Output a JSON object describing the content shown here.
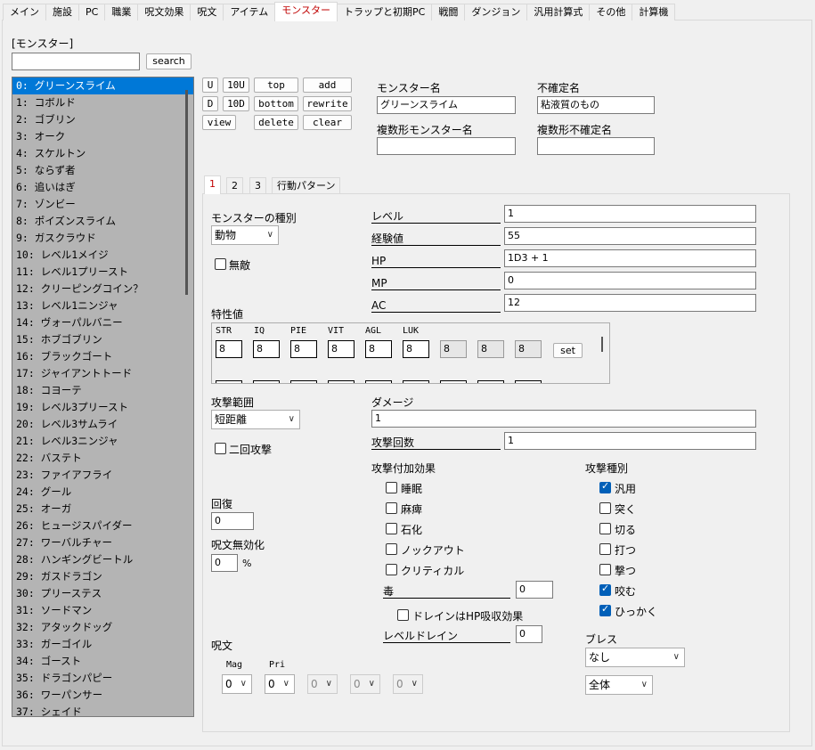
{
  "tabs": [
    "メイン",
    "施設",
    "PC",
    "職業",
    "呪文効果",
    "呪文",
    "アイテム",
    "モンスター",
    "トラップと初期PC",
    "戦闘",
    "ダンジョン",
    "汎用計算式",
    "その他",
    "計算機"
  ],
  "section_title": "[モンスター]",
  "search": {
    "value": "",
    "button": "search"
  },
  "monsters": [
    "0: グリーンスライム",
    "1: コボルド",
    "2: ゴブリン",
    "3: オーク",
    "4: スケルトン",
    "5: ならず者",
    "6: 追いはぎ",
    "7: ゾンビー",
    "8: ポイズンスライム",
    "9: ガスクラウド",
    "10: レベル1メイジ",
    "11: レベル1プリースト",
    "12: クリーピングコイン？",
    "13: レベル1ニンジャ",
    "14: ヴォーパルバニー",
    "15: ホブゴブリン",
    "16: ブラックゴート",
    "17: ジャイアントトード",
    "18: コヨーテ",
    "19: レベル3プリースト",
    "20: レベル3サムライ",
    "21: レベル3ニンジャ",
    "22: バステト",
    "23: ファイアフライ",
    "24: グール",
    "25: オーガ",
    "26: ヒュージスパイダー",
    "27: ワーバルチャー",
    "28: ハンギングビートル",
    "29: ガスドラゴン",
    "30: プリーステス",
    "31: ソードマン",
    "32: アタックドッグ",
    "33: ガーゴイル",
    "34: ゴースト",
    "35: ドラゴンパピー",
    "36: ワーパンサー",
    "37: シェイド"
  ],
  "buttons": {
    "u": "U",
    "u10": "10U",
    "top": "top",
    "add": "add",
    "d": "D",
    "d10": "10D",
    "bottom": "bottom",
    "rewrite": "rewrite",
    "view": "view",
    "delete": "delete",
    "clear": "clear"
  },
  "name_label": "モンスター名",
  "name_value": "グリーンスライム",
  "uncertain_label": "不確定名",
  "uncertain_value": "粘液質のもの",
  "plural_label": "複数形モンスター名",
  "plural_value": "",
  "plural_uncertain_label": "複数形不確定名",
  "plural_uncertain_value": "",
  "inner_tabs": [
    "1",
    "2",
    "3",
    "行動パターン"
  ],
  "kind_label": "モンスターの種別",
  "kind_value": "動物",
  "invincible_label": "無敵",
  "fields": {
    "level": {
      "label": "レベル",
      "value": "1"
    },
    "exp": {
      "label": "経験値",
      "value": "55"
    },
    "hp": {
      "label": "HP",
      "value": "1D3 + 1"
    },
    "mp": {
      "label": "MP",
      "value": "0"
    },
    "ac": {
      "label": "AC",
      "value": "12"
    }
  },
  "traits_label": "特性値",
  "stat_headers": [
    "STR",
    "IQ",
    "PIE",
    "VIT",
    "AGL",
    "LUK"
  ],
  "stat_values": [
    "8",
    "8",
    "8",
    "8",
    "8",
    "8",
    "8",
    "8",
    "8"
  ],
  "set_button": "set",
  "range_label": "攻撃範囲",
  "range_value": "短距離",
  "double_attack_label": "二回攻撃",
  "damage_label": "ダメージ",
  "damage_value": "1",
  "attack_count_label": "攻撃回数",
  "attack_count_value": "1",
  "effects_label": "攻撃付加効果",
  "effects": [
    "睡眠",
    "麻痺",
    "石化",
    "ノックアウト",
    "クリティカル"
  ],
  "poison_label": "毒",
  "poison_value": "0",
  "drain_hp_label": "ドレインはHP吸収効果",
  "level_drain_label": "レベルドレイン",
  "level_drain_value": "0",
  "attack_types_label": "攻撃種別",
  "attack_types": [
    {
      "label": "汎用",
      "checked": true
    },
    {
      "label": "突く",
      "checked": false
    },
    {
      "label": "切る",
      "checked": false
    },
    {
      "label": "打つ",
      "checked": false
    },
    {
      "label": "撃つ",
      "checked": false
    },
    {
      "label": "咬む",
      "checked": true
    },
    {
      "label": "ひっかく",
      "checked": true
    }
  ],
  "heal_label": "回復",
  "heal_value": "0",
  "nullify_label": "呪文無効化",
  "nullify_value": "0",
  "nullify_unit": "%",
  "spell_label": "呪文",
  "mag_label": "Mag",
  "pri_label": "Pri",
  "spell_selects": [
    "0",
    "0",
    "0",
    "0",
    "0"
  ],
  "breath_label": "ブレス",
  "breath_value": "なし",
  "breath_target": "全体"
}
